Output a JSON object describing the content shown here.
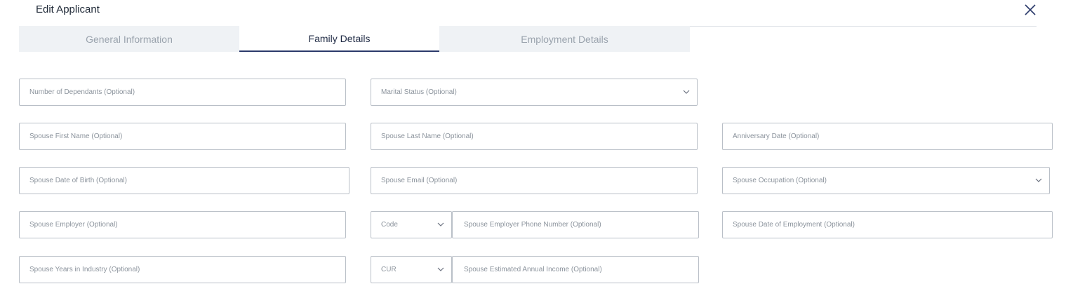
{
  "dialog": {
    "title": "Edit Applicant"
  },
  "tabs": [
    {
      "label": "General Information"
    },
    {
      "label": "Family Details"
    },
    {
      "label": "Employment Details"
    }
  ],
  "fields": {
    "dependants": "Number of Dependants (Optional)",
    "marital_status": "Marital Status (Optional)",
    "spouse_first_name": "Spouse First Name (Optional)",
    "spouse_last_name": "Spouse Last Name (Optional)",
    "anniversary_date": "Anniversary Date (Optional)",
    "spouse_dob": "Spouse Date of Birth (Optional)",
    "spouse_email": "Spouse Email (Optional)",
    "spouse_occupation": "Spouse Occupation (Optional)",
    "spouse_employer": "Spouse Employer (Optional)",
    "phone_code": "Code",
    "spouse_employer_phone": "Spouse Employer Phone Number (Optional)",
    "spouse_date_of_employment": "Spouse Date of Employment (Optional)",
    "spouse_years_in_industry": "Spouse Years in Industry (Optional)",
    "currency": "CUR",
    "spouse_income": "Spouse Estimated Annual Income (Optional)"
  },
  "colors": {
    "accent": "#2b3a6b",
    "tab_bg": "#eff2f5",
    "border": "#b9bfc7"
  },
  "icons": {
    "close": "close-icon",
    "dropdown": "chevron-down-icon"
  }
}
